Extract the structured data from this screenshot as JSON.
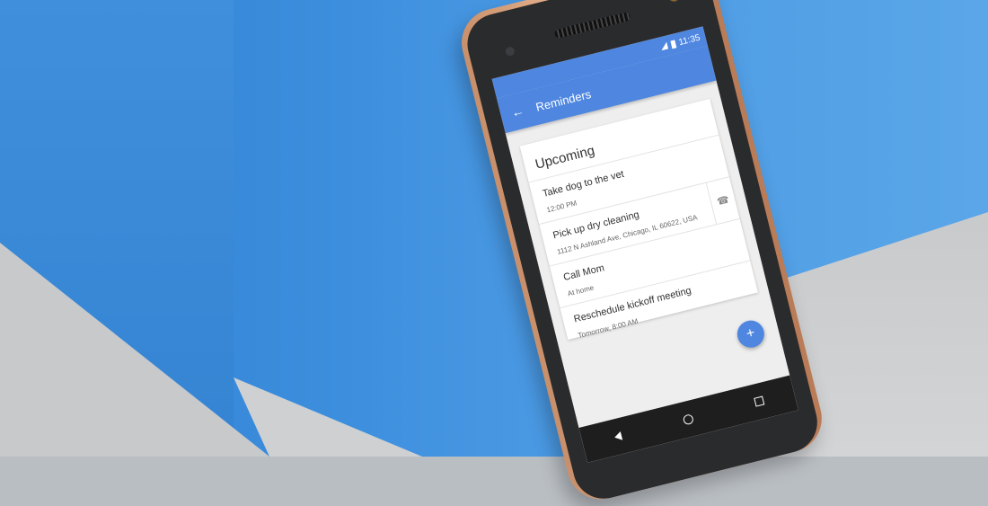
{
  "status_bar": {
    "time": "11:35"
  },
  "app_bar": {
    "title": "Reminders"
  },
  "section": {
    "title": "Upcoming"
  },
  "reminders": [
    {
      "title": "Take dog to the vet",
      "subtitle": "12:00 PM"
    },
    {
      "title": "Pick up dry cleaning",
      "subtitle": "1112 N Ashland Ave, Chicago, IL 60622, USA"
    },
    {
      "title": "Call Mom",
      "subtitle": "At home"
    },
    {
      "title": "Reschedule kickoff meeting",
      "subtitle": "Tomorrow, 8:00 AM"
    }
  ],
  "icons": {
    "back": "arrow-left-icon",
    "call": "phone-icon",
    "fab": "plus-icon"
  },
  "colors": {
    "accent": "#4e86e0",
    "wall": "#3d8fde",
    "floor": "#c8c9cb",
    "phone_frame": "#e3b08b"
  }
}
